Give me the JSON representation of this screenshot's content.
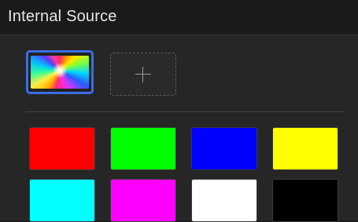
{
  "panel": {
    "title": "Internal Source"
  },
  "sources": {
    "selected_thumbnail": "colorful-burst-image",
    "add_icon": "plus-icon"
  },
  "colors": [
    {
      "name": "red",
      "hex": "#ff0000"
    },
    {
      "name": "green",
      "hex": "#00ff00"
    },
    {
      "name": "blue",
      "hex": "#0000ff"
    },
    {
      "name": "yellow",
      "hex": "#ffff00"
    },
    {
      "name": "cyan",
      "hex": "#00ffff"
    },
    {
      "name": "magenta",
      "hex": "#ff00ff"
    },
    {
      "name": "white",
      "hex": "#ffffff"
    },
    {
      "name": "black",
      "hex": "#000000"
    }
  ],
  "accent": "#3a6de8"
}
